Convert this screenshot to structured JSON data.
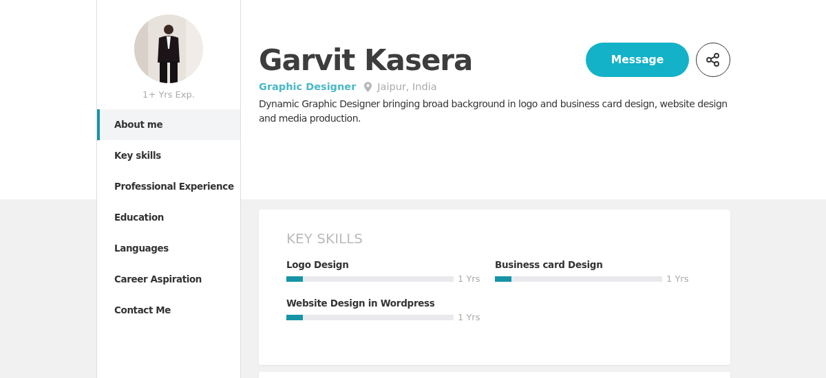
{
  "profile": {
    "experience": "1+ Yrs Exp.",
    "name": "Garvit Kasera",
    "role": "Graphic Designer",
    "location": "Jaipur, India",
    "summary": "Dynamic Graphic Designer bringing broad background in logo and business card design, website design and media production.",
    "message_button": "Message"
  },
  "sidebar": {
    "items": [
      {
        "label": "About me",
        "selected": true
      },
      {
        "label": "Key skills",
        "selected": false
      },
      {
        "label": "Professional Experience",
        "selected": false
      },
      {
        "label": "Education",
        "selected": false
      },
      {
        "label": "Languages",
        "selected": false
      },
      {
        "label": "Career Aspiration",
        "selected": false
      },
      {
        "label": "Contact Me",
        "selected": false
      }
    ]
  },
  "key_skills": {
    "title": "KEY SKILLS",
    "skills": [
      {
        "name": "Logo Design",
        "level": 0.1,
        "reading": "1 Yrs"
      },
      {
        "name": "Business card Design",
        "level": 0.1,
        "reading": "1 Yrs"
      },
      {
        "name": "Website Design in Wordpress",
        "level": 0.1,
        "reading": "1 Yrs"
      }
    ]
  }
}
